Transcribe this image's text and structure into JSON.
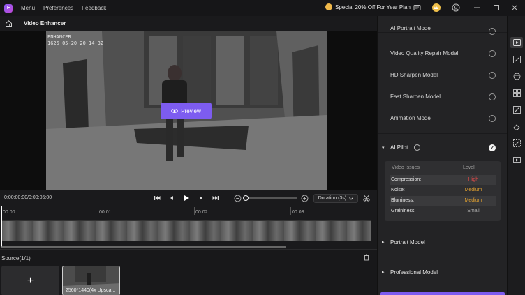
{
  "topbar": {
    "menus": [
      "Menu",
      "Preferences",
      "Feedback"
    ],
    "promo": "Special 20% Off For Year Plan"
  },
  "subbar": {
    "title": "Video Enhancer"
  },
  "video": {
    "stamp_line1": "ENHANCER",
    "stamp_line2": "1625 05-20 20 14 32",
    "preview_label": "Preview"
  },
  "transport": {
    "timecode": "0:00:00:00/0:00:05:00",
    "duration_label": "Duration (3s)"
  },
  "timeline": {
    "ruler": [
      "00:00",
      "00:01",
      "00:02",
      "00:03"
    ],
    "zoom": 0.0
  },
  "source": {
    "label": "Source(1/1)",
    "add_label": "+",
    "thumb_label": "2560*1440(4x Upsca..."
  },
  "panel": {
    "models": [
      "AI Portrait Model",
      "Video Quality Repair Model",
      "HD Sharpen Model",
      "Fast Sharpen Model",
      "Animation Model"
    ],
    "ai_pilot": {
      "title": "AI Pilot",
      "col_issue": "Video Issues",
      "col_level": "Level",
      "issues": [
        {
          "name": "Compression:",
          "level": "High",
          "color": "#e34a4a"
        },
        {
          "name": "Noise:",
          "level": "Medium",
          "color": "#e0a030"
        },
        {
          "name": "Blurriness:",
          "level": "Medium",
          "color": "#e0a030"
        },
        {
          "name": "Graininess:",
          "level": "Small",
          "color": "#b0b0b0"
        }
      ]
    },
    "sections": [
      "Portrait Model",
      "Professional Model"
    ]
  }
}
